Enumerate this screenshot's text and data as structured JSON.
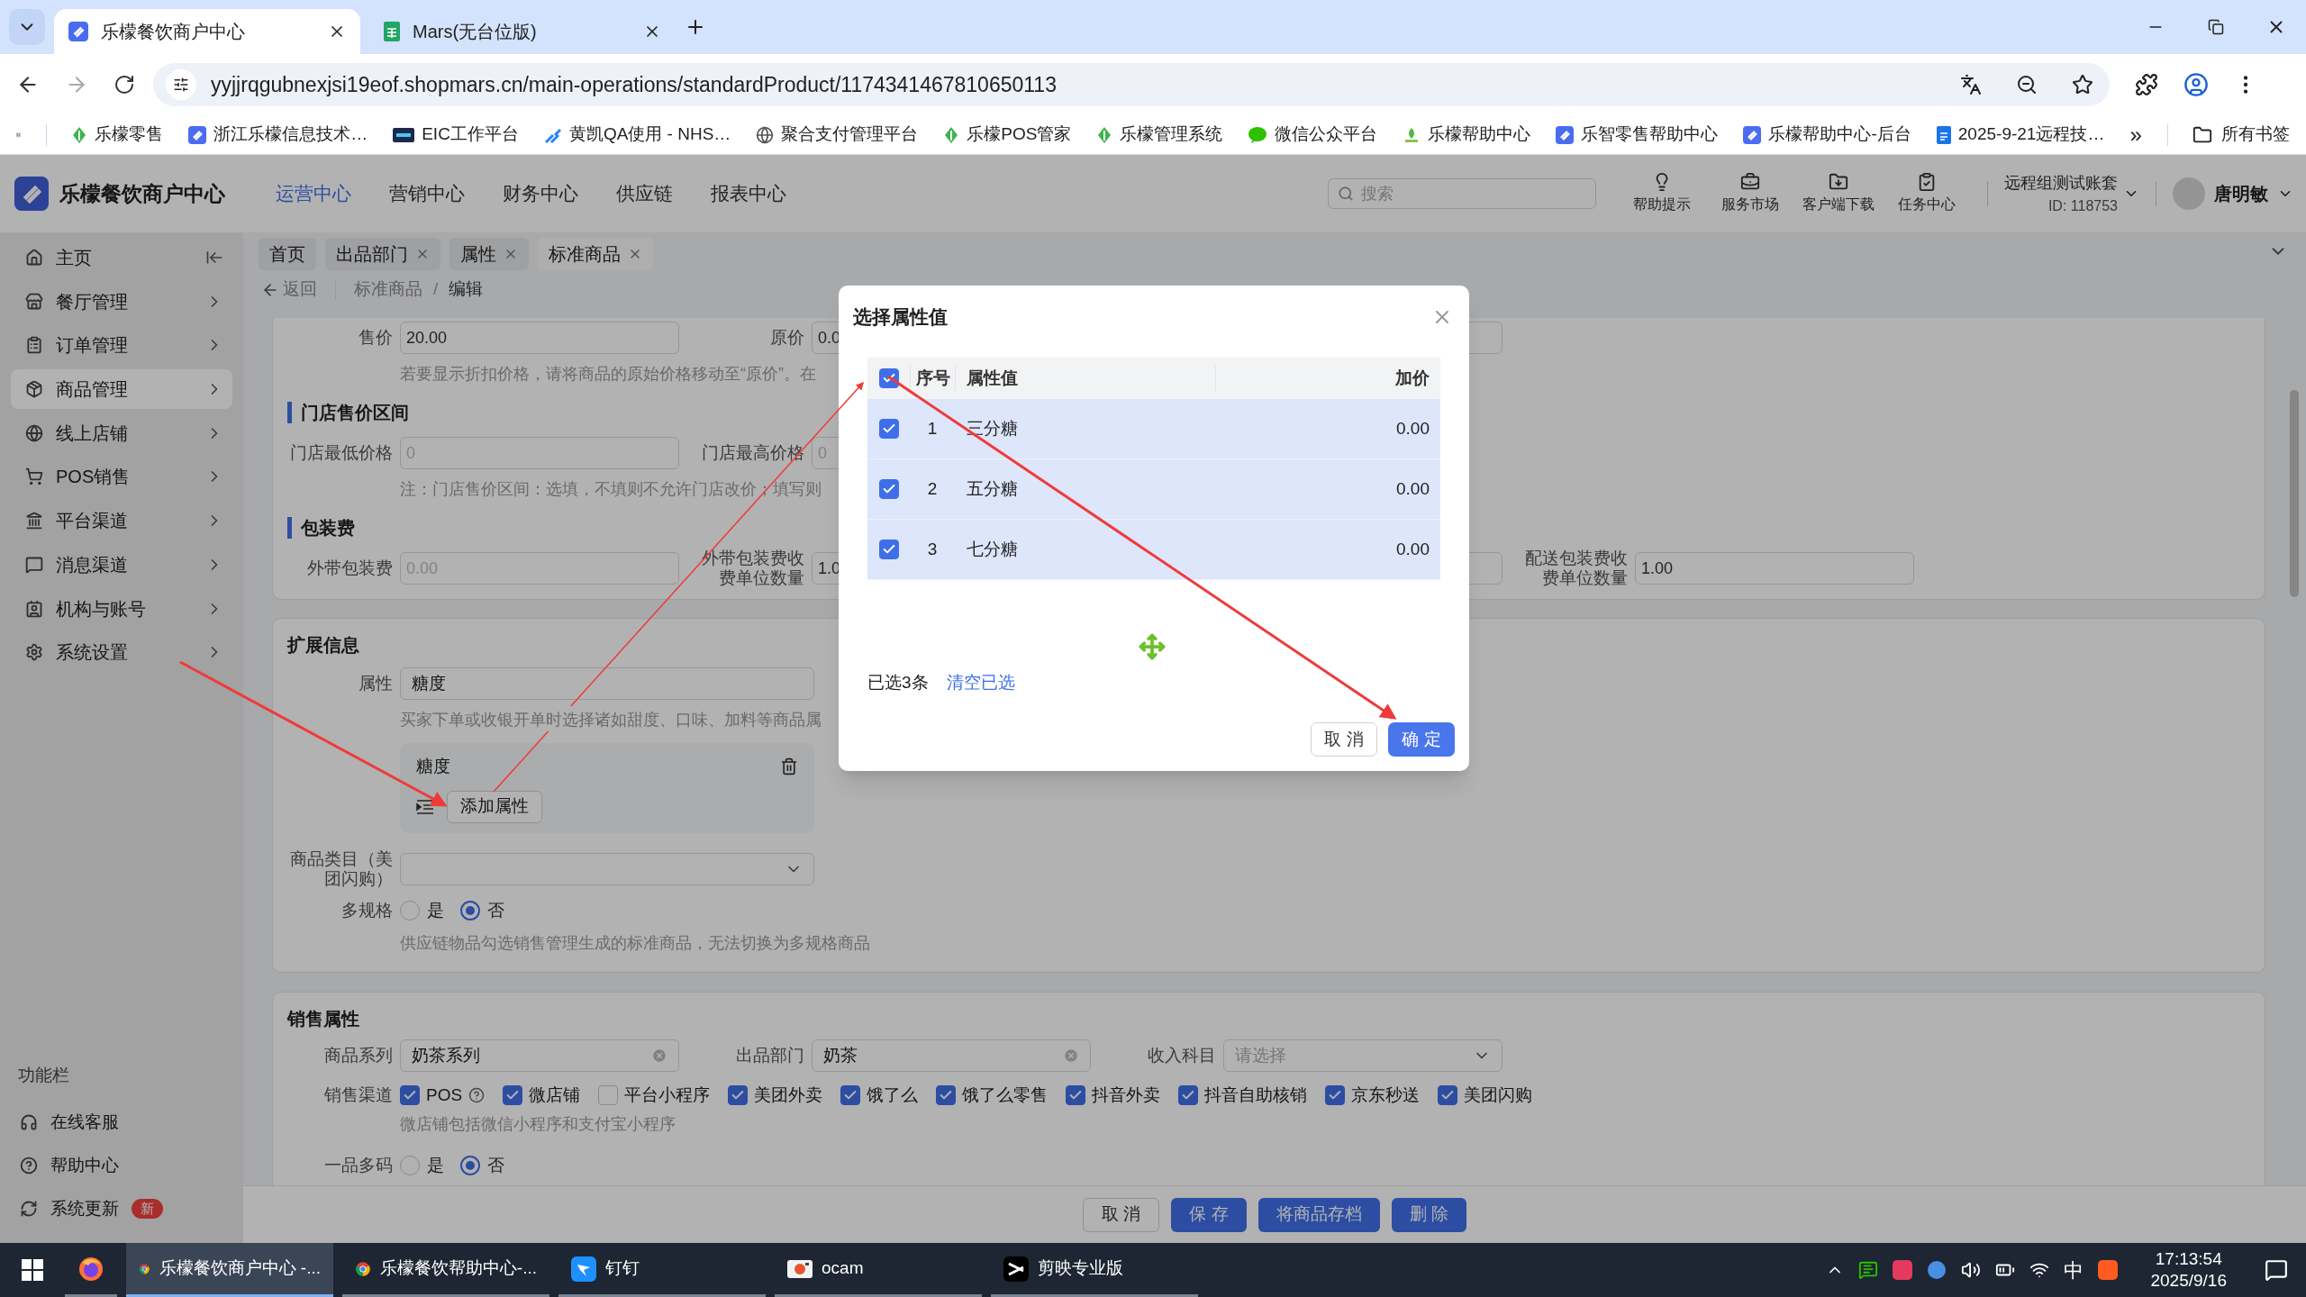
{
  "browser": {
    "tabs": [
      {
        "title": "乐檬餐饮商户中心",
        "kind": "app",
        "selected": true
      },
      {
        "title": "Mars(无台位版)",
        "kind": "sheet",
        "selected": false
      }
    ],
    "url": "yyjjrqgubnexjsi19eof.shopmars.cn/main-operations/standardProduct/1174341467810650113",
    "bookmarks": [
      {
        "label": "乐檬零售",
        "kind": "leaf"
      },
      {
        "label": "浙江乐檬信息技术…",
        "kind": "app"
      },
      {
        "label": "EIC工作平台",
        "kind": "eic"
      },
      {
        "label": "黄凯QA使用 - NHS…",
        "kind": "jira"
      },
      {
        "label": "聚合支付管理平台",
        "kind": "globe"
      },
      {
        "label": "乐檬POS管家",
        "kind": "leaf"
      },
      {
        "label": "乐檬管理系统",
        "kind": "leaf"
      },
      {
        "label": "微信公众平台",
        "kind": "wechat"
      },
      {
        "label": "乐檬帮助中心",
        "kind": "lemon"
      },
      {
        "label": "乐智零售帮助中心",
        "kind": "app"
      },
      {
        "label": "乐檬帮助中心-后台",
        "kind": "app"
      },
      {
        "label": "2025-9-21远程技…",
        "kind": "doc"
      }
    ],
    "more": "»",
    "all_bookmarks": "所有书签"
  },
  "header": {
    "title": "乐檬餐饮商户中心",
    "nav": [
      {
        "label": "运营中心",
        "selected": true
      },
      {
        "label": "营销中心",
        "selected": false
      },
      {
        "label": "财务中心",
        "selected": false
      },
      {
        "label": "供应链",
        "selected": false
      },
      {
        "label": "报表中心",
        "selected": false
      }
    ],
    "search": {
      "placeholder": "搜索"
    },
    "tools": [
      {
        "label": "帮助提示",
        "kind": "bulb"
      },
      {
        "label": "服务市场",
        "kind": "case"
      },
      {
        "label": "客户端下载",
        "kind": "download"
      },
      {
        "label": "任务中心",
        "kind": "task"
      }
    ],
    "account": {
      "name": "远程组测试账套",
      "id": "ID: 118753"
    },
    "user": "唐明敏"
  },
  "sidebar": {
    "items": [
      {
        "label": "主页",
        "kind": "home",
        "selected": false
      },
      {
        "label": "餐厅管理",
        "kind": "restaurant",
        "selected": false
      },
      {
        "label": "订单管理",
        "kind": "order",
        "selected": false
      },
      {
        "label": "商品管理",
        "kind": "product",
        "selected": true
      },
      {
        "label": "线上店铺",
        "kind": "online",
        "selected": false
      },
      {
        "label": "POS销售",
        "kind": "pos",
        "selected": false
      },
      {
        "label": "平台渠道",
        "kind": "platform",
        "selected": false
      },
      {
        "label": "消息渠道",
        "kind": "message",
        "selected": false
      },
      {
        "label": "机构与账号",
        "kind": "org",
        "selected": false
      },
      {
        "label": "系统设置",
        "kind": "settings",
        "selected": false
      }
    ],
    "section": "功能栏",
    "footer": [
      {
        "label": "在线客服",
        "kind": "service"
      },
      {
        "label": "帮助中心",
        "kind": "help"
      },
      {
        "label": "系统更新",
        "kind": "update",
        "badge": "新"
      }
    ]
  },
  "page_tabs": [
    {
      "label": "首页",
      "closable": false,
      "selected": false
    },
    {
      "label": "出品部门",
      "closable": true,
      "selected": false
    },
    {
      "label": "属性",
      "closable": true,
      "selected": false
    },
    {
      "label": "标准商品",
      "closable": true,
      "selected": true
    }
  ],
  "breadcrumb": {
    "back": "返回",
    "path": [
      "标准商品",
      "编辑"
    ],
    "separator": "/"
  },
  "pricing": {
    "rows": [
      {
        "kind": "fields",
        "fields": [
          {
            "kind": "input",
            "label": "售价",
            "value": "20.00"
          },
          {
            "kind": "input",
            "label": "原价",
            "value": "0.0"
          },
          {
            "kind": "input"
          }
        ]
      },
      {
        "kind": "hint",
        "text": "若要显示折扣价格，请将商品的原始价格移动至“原价”。在"
      },
      {
        "kind": "section",
        "text": "门店售价区间"
      },
      {
        "kind": "fields",
        "fields": [
          {
            "kind": "input",
            "label": "门店最低价格",
            "placeholder": "0"
          },
          {
            "kind": "input",
            "label": "门店最高价格",
            "placeholder": "0"
          }
        ]
      },
      {
        "kind": "hint",
        "text": "注：门店售价区间：选填，不填则不允许门店改价；填写则"
      },
      {
        "kind": "section",
        "text": "包装费"
      },
      {
        "kind": "fields",
        "fields": [
          {
            "kind": "input",
            "label": "外带包装费",
            "placeholder": "0.00"
          },
          {
            "kind": "input",
            "label": "外带包装费收费单位数量",
            "value": "1.0"
          },
          {
            "kind": "input"
          },
          {
            "kind": "input",
            "label": "配送包装费收费单位数量",
            "value": "1.00"
          }
        ]
      }
    ]
  },
  "extension": {
    "title": "扩展信息",
    "attribute": {
      "label": "属性",
      "value": "糖度"
    },
    "attribute_hint": "买家下单或收银开单时选择诸如甜度、口味、加料等商品属",
    "attribute_group": {
      "name": "糖度",
      "button": "添加属性"
    },
    "category": {
      "label": "商品类目（美团闪购）"
    },
    "multi_spec": {
      "label": "多规格",
      "options": [
        {
          "label": "是",
          "selected": false
        },
        {
          "label": "否",
          "selected": true
        }
      ]
    },
    "multi_spec_hint": "供应链物品勾选销售管理生成的标准商品，无法切换为多规格商品"
  },
  "sales": {
    "title": "销售属性",
    "selects": [
      {
        "label": "商品系列",
        "value": "奶茶系列",
        "kind": "clear"
      },
      {
        "label": "出品部门",
        "value": "奶茶",
        "kind": "clear"
      },
      {
        "label": "收入科目",
        "placeholder": "请选择",
        "kind": "dropdown"
      }
    ],
    "channels": {
      "label": "销售渠道",
      "options": [
        {
          "label": "POS",
          "checked": true,
          "kind": "help"
        },
        {
          "label": "微店铺",
          "checked": true,
          "kind": "plain"
        },
        {
          "label": "平台小程序",
          "checked": false,
          "kind": "plain"
        },
        {
          "label": "美团外卖",
          "checked": true,
          "kind": "plain"
        },
        {
          "label": "饿了么",
          "checked": true,
          "kind": "plain"
        },
        {
          "label": "饿了么零售",
          "checked": true,
          "kind": "plain"
        },
        {
          "label": "抖音外卖",
          "checked": true,
          "kind": "plain"
        },
        {
          "label": "抖音自助核销",
          "checked": true,
          "kind": "plain"
        },
        {
          "label": "京东秒送",
          "checked": true,
          "kind": "plain"
        },
        {
          "label": "美团闪购",
          "checked": true,
          "kind": "plain"
        }
      ]
    },
    "channels_hint": "微店铺包括微信小程序和支付宝小程序",
    "multi_code": {
      "label": "一品多码",
      "options": [
        {
          "label": "是",
          "selected": false
        },
        {
          "label": "否",
          "selected": true
        }
      ]
    }
  },
  "actions": [
    {
      "label": "取 消",
      "kind": "default"
    },
    {
      "label": "保 存",
      "kind": "primary"
    },
    {
      "label": "将商品存档",
      "kind": "primary"
    },
    {
      "label": "删 除",
      "kind": "primary"
    }
  ],
  "modal": {
    "title": "选择属性值",
    "columns": [
      "序号",
      "属性值",
      "加价"
    ],
    "all_checked": true,
    "rows": [
      {
        "index": "1",
        "value": "三分糖",
        "price": "0.00",
        "checked": true
      },
      {
        "index": "2",
        "value": "五分糖",
        "price": "0.00",
        "checked": true
      },
      {
        "index": "3",
        "value": "七分糖",
        "price": "0.00",
        "checked": true
      }
    ],
    "selected_count": "已选3条",
    "clear": "清空已选",
    "buttons": [
      {
        "label": "取 消",
        "kind": "default"
      },
      {
        "label": "确 定",
        "kind": "primary"
      }
    ]
  },
  "taskbar": {
    "apps": [
      {
        "kind": "firefox",
        "selected": false
      },
      {
        "label": "乐檬餐饮商户中心 -...",
        "kind": "chrome",
        "selected": true
      },
      {
        "label": "乐檬餐饮帮助中心-...",
        "kind": "chrome",
        "selected": false
      },
      {
        "label": "钉钉",
        "kind": "dingtalk",
        "selected": false
      },
      {
        "label": "ocam",
        "kind": "ocam",
        "selected": false
      },
      {
        "label": "剪映专业版",
        "kind": "capcut",
        "selected": false
      }
    ],
    "ime": "中",
    "time": "17:13:54",
    "date": "2025/9/16"
  }
}
